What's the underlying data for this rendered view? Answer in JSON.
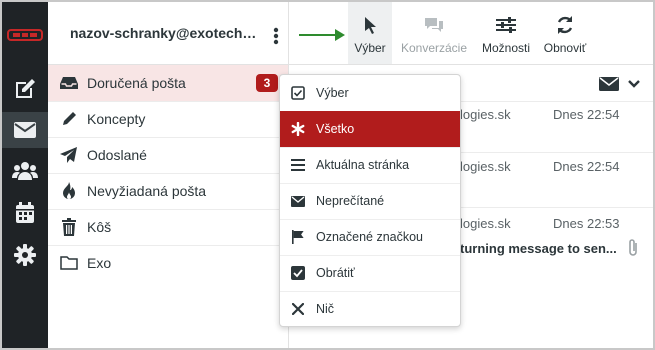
{
  "account": {
    "name": "nazov-schranky@exotechnol..."
  },
  "folders": [
    {
      "label": "Doručená pošta",
      "icon": "inbox-icon",
      "badge": "3"
    },
    {
      "label": "Koncepty",
      "icon": "pencil-icon"
    },
    {
      "label": "Odoslané",
      "icon": "paper-plane-icon"
    },
    {
      "label": "Nevyžiadaná pošta",
      "icon": "fire-icon"
    },
    {
      "label": "Kôš",
      "icon": "trash-icon"
    },
    {
      "label": "Exo",
      "icon": "folder-icon"
    }
  ],
  "rail": [
    {
      "icon": "logo-icon"
    },
    {
      "icon": "compose-icon"
    },
    {
      "icon": "mail-icon"
    },
    {
      "icon": "contacts-icon"
    },
    {
      "icon": "calendar-icon"
    },
    {
      "icon": "settings-icon"
    }
  ],
  "toolbar": {
    "select": "Výber",
    "conversations": "Konverzácie",
    "options": "Možnosti",
    "refresh": "Obnoviť"
  },
  "menu": {
    "items": [
      {
        "label": "Výber",
        "icon": "checkbox-icon"
      },
      {
        "label": "Všetko",
        "icon": "asterisk-icon"
      },
      {
        "label": "Aktuálna stránka",
        "icon": "list-icon"
      },
      {
        "label": "Neprečítané",
        "icon": "envelope-icon"
      },
      {
        "label": "Označené značkou",
        "icon": "flag-icon"
      },
      {
        "label": "Obrátiť",
        "icon": "checked-box-icon"
      },
      {
        "label": "Nič",
        "icon": "close-icon"
      }
    ]
  },
  "messages": [
    {
      "from_fragment": "logies.sk",
      "date": "Dnes 22:54"
    },
    {
      "from_fragment": "logies.sk",
      "date": "Dnes 22:54"
    },
    {
      "from_fragment": "logies.sk",
      "date": "Dnes 22:53",
      "subject_fragment": "turning message to sen..."
    }
  ],
  "colors": {
    "accent": "#b11c1c",
    "rail": "#1f2326",
    "arrow": "#2e8b2e"
  }
}
